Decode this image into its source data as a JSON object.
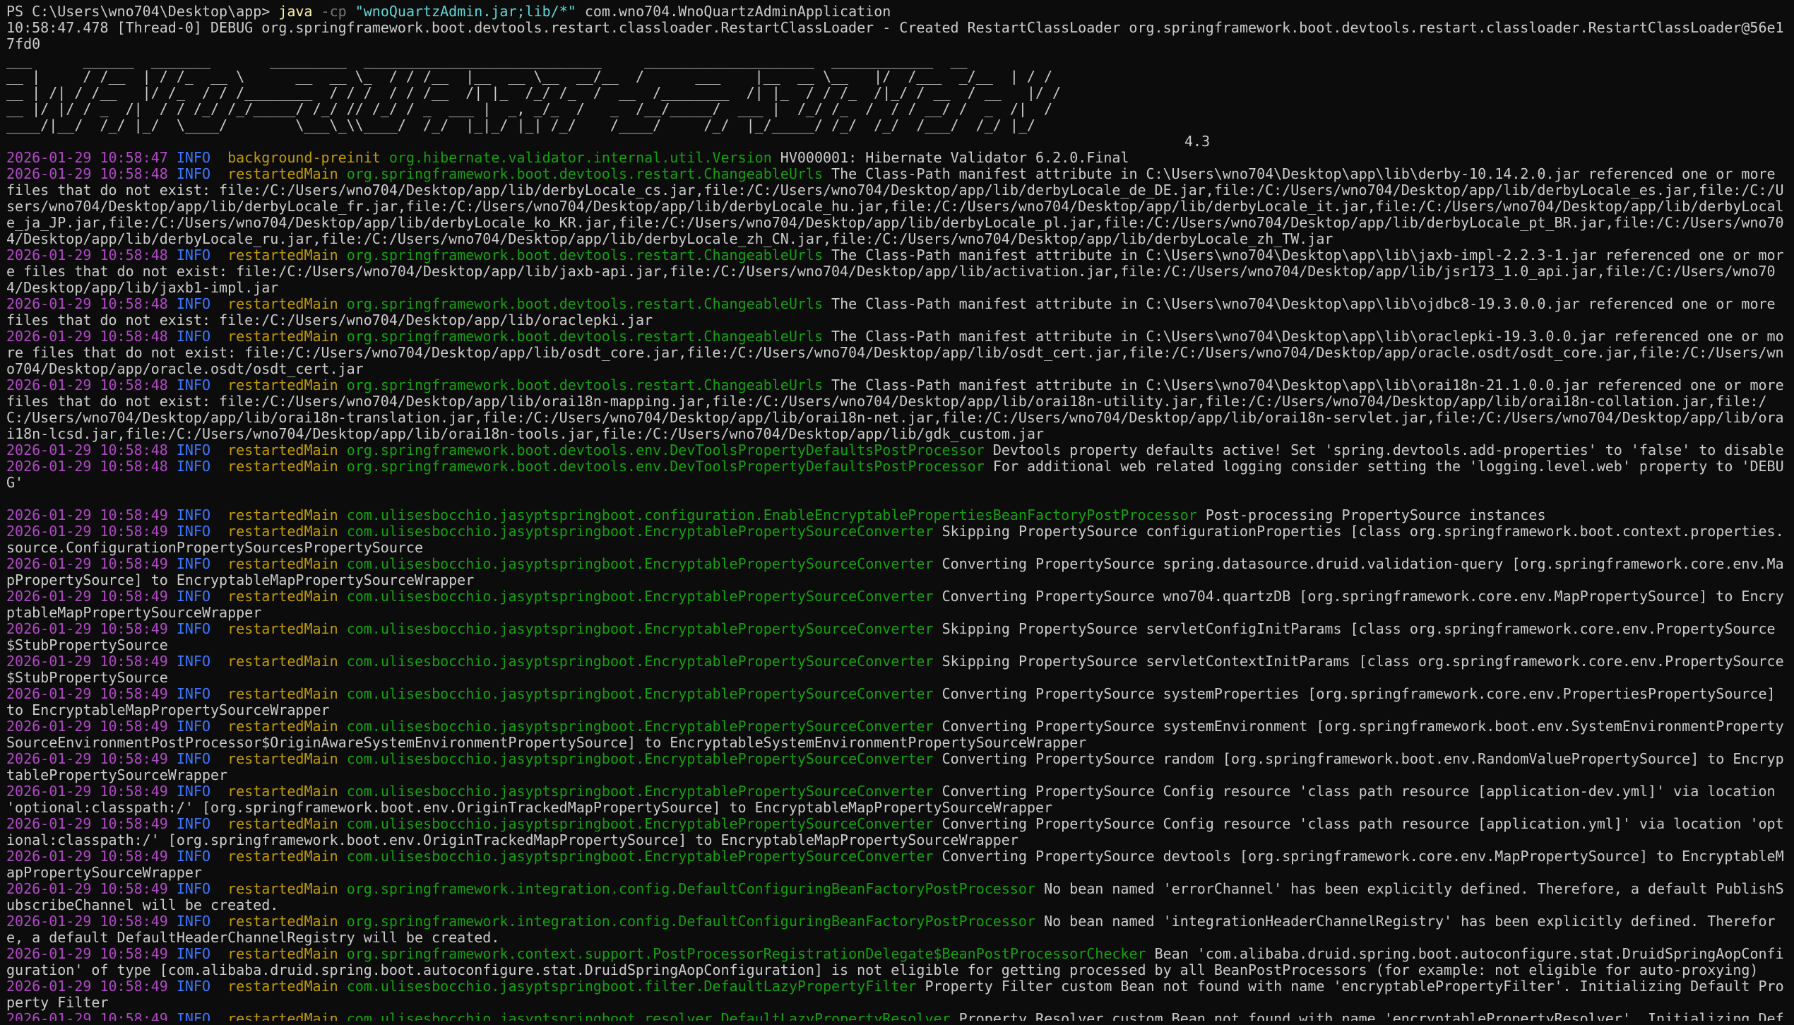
{
  "terminal": {
    "prompt": "PS C:\\Users\\wno704\\Desktop\\app> ",
    "command": {
      "program": "java",
      "flag": "-cp",
      "classpath": "\"wnoQuartzAdmin.jar;lib/*\"",
      "main_class": "com.wno704.WnoQuartzAdminApplication"
    },
    "debug_line": "10:58:47.478 [Thread-0] DEBUG org.springframework.boot.devtools.restart.classloader.RestartClassLoader - Created RestartClassLoader org.springframework.boot.devtools.restart.classloader.RestartClassLoader@56e17fd0",
    "banner_lines": [
      "___      ______  _______       _________  ____________________________     ____________________  ____________  __",
      "__ |     / /__  | / /_  __ \\      __  __ \\_  / / /__  |__  __ \\__  __/__  /      ___    |__  __ \\__   |/  /___  _/__  | / /",
      "__ | /| / /__   |/ /_  / / /________  / / /  / / /__  /| |_  /_/ /_  /  __  /________  /| |_  / / /_  /|_/ / __  / __   |/ /",
      "__ |/ |/ / _  /|  / / /_/ /_/_____/ /_/ // /_/ / _  ___ |  _, _/_  /   _  /__/_____/  ___ |  /_/ /_  /  / / __/ /  _  /|  /",
      "____/|__/  /_/ |_/  \\____/        \\___\\_\\\\____/  /_/  |_|_/ |_| /_/    /____/     /_/  |_/_____/ /_/  /_/  /___/  /_/ |_/"
    ],
    "version": "4.3",
    "log_entries": [
      {
        "date": "2026-01-29 10:58:47",
        "level": "INFO",
        "thread": "background-preinit",
        "logger": "org.hibernate.validator.internal.util.Version",
        "message": "HV000001: Hibernate Validator 6.2.0.Final"
      },
      {
        "date": "2026-01-29 10:58:48",
        "level": "INFO",
        "thread": "restartedMain",
        "logger": "org.springframework.boot.devtools.restart.ChangeableUrls",
        "message": "The Class-Path manifest attribute in C:\\Users\\wno704\\Desktop\\app\\lib\\derby-10.14.2.0.jar referenced one or more files that do not exist: file:/C:/Users/wno704/Desktop/app/lib/derbyLocale_cs.jar,file:/C:/Users/wno704/Desktop/app/lib/derbyLocale_de_DE.jar,file:/C:/Users/wno704/Desktop/app/lib/derbyLocale_es.jar,file:/C:/Users/wno704/Desktop/app/lib/derbyLocale_fr.jar,file:/C:/Users/wno704/Desktop/app/lib/derbyLocale_hu.jar,file:/C:/Users/wno704/Desktop/app/lib/derbyLocale_it.jar,file:/C:/Users/wno704/Desktop/app/lib/derbyLocale_ja_JP.jar,file:/C:/Users/wno704/Desktop/app/lib/derbyLocale_ko_KR.jar,file:/C:/Users/wno704/Desktop/app/lib/derbyLocale_pl.jar,file:/C:/Users/wno704/Desktop/app/lib/derbyLocale_pt_BR.jar,file:/C:/Users/wno704/Desktop/app/lib/derbyLocale_ru.jar,file:/C:/Users/wno704/Desktop/app/lib/derbyLocale_zh_CN.jar,file:/C:/Users/wno704/Desktop/app/lib/derbyLocale_zh_TW.jar"
      },
      {
        "date": "2026-01-29 10:58:48",
        "level": "INFO",
        "thread": "restartedMain",
        "logger": "org.springframework.boot.devtools.restart.ChangeableUrls",
        "message": "The Class-Path manifest attribute in C:\\Users\\wno704\\Desktop\\app\\lib\\jaxb-impl-2.2.3-1.jar referenced one or more files that do not exist: file:/C:/Users/wno704/Desktop/app/lib/jaxb-api.jar,file:/C:/Users/wno704/Desktop/app/lib/activation.jar,file:/C:/Users/wno704/Desktop/app/lib/jsr173_1.0_api.jar,file:/C:/Users/wno704/Desktop/app/lib/jaxb1-impl.jar"
      },
      {
        "date": "2026-01-29 10:58:48",
        "level": "INFO",
        "thread": "restartedMain",
        "logger": "org.springframework.boot.devtools.restart.ChangeableUrls",
        "message": "The Class-Path manifest attribute in C:\\Users\\wno704\\Desktop\\app\\lib\\ojdbc8-19.3.0.0.jar referenced one or more files that do not exist: file:/C:/Users/wno704/Desktop/app/lib/oraclepki.jar"
      },
      {
        "date": "2026-01-29 10:58:48",
        "level": "INFO",
        "thread": "restartedMain",
        "logger": "org.springframework.boot.devtools.restart.ChangeableUrls",
        "message": "The Class-Path manifest attribute in C:\\Users\\wno704\\Desktop\\app\\lib\\oraclepki-19.3.0.0.jar referenced one or more files that do not exist: file:/C:/Users/wno704/Desktop/app/lib/osdt_core.jar,file:/C:/Users/wno704/Desktop/app/lib/osdt_cert.jar,file:/C:/Users/wno704/Desktop/app/oracle.osdt/osdt_core.jar,file:/C:/Users/wno704/Desktop/app/oracle.osdt/osdt_cert.jar"
      },
      {
        "date": "2026-01-29 10:58:48",
        "level": "INFO",
        "thread": "restartedMain",
        "logger": "org.springframework.boot.devtools.restart.ChangeableUrls",
        "message": "The Class-Path manifest attribute in C:\\Users\\wno704\\Desktop\\app\\lib\\orai18n-21.1.0.0.jar referenced one or more files that do not exist: file:/C:/Users/wno704/Desktop/app/lib/orai18n-mapping.jar,file:/C:/Users/wno704/Desktop/app/lib/orai18n-utility.jar,file:/C:/Users/wno704/Desktop/app/lib/orai18n-collation.jar,file:/C:/Users/wno704/Desktop/app/lib/orai18n-translation.jar,file:/C:/Users/wno704/Desktop/app/lib/orai18n-net.jar,file:/C:/Users/wno704/Desktop/app/lib/orai18n-servlet.jar,file:/C:/Users/wno704/Desktop/app/lib/orai18n-lcsd.jar,file:/C:/Users/wno704/Desktop/app/lib/orai18n-tools.jar,file:/C:/Users/wno704/Desktop/app/lib/gdk_custom.jar"
      },
      {
        "date": "2026-01-29 10:58:48",
        "level": "INFO",
        "thread": "restartedMain",
        "logger": "org.springframework.boot.devtools.env.DevToolsPropertyDefaultsPostProcessor",
        "message": "Devtools property defaults active! Set 'spring.devtools.add-properties' to 'false' to disable"
      },
      {
        "date": "2026-01-29 10:58:48",
        "level": "INFO",
        "thread": "restartedMain",
        "logger": "org.springframework.boot.devtools.env.DevToolsPropertyDefaultsPostProcessor",
        "message": "For additional web related logging consider setting the 'logging.level.web' property to 'DEBUG'"
      },
      {
        "date": "",
        "level": "",
        "thread": "",
        "logger": "",
        "message": ""
      },
      {
        "date": "2026-01-29 10:58:49",
        "level": "INFO",
        "thread": "restartedMain",
        "logger": "com.ulisesbocchio.jasyptspringboot.configuration.EnableEncryptablePropertiesBeanFactoryPostProcessor",
        "message": "Post-processing PropertySource instances"
      },
      {
        "date": "2026-01-29 10:58:49",
        "level": "INFO",
        "thread": "restartedMain",
        "logger": "com.ulisesbocchio.jasyptspringboot.EncryptablePropertySourceConverter",
        "message": "Skipping PropertySource configurationProperties [class org.springframework.boot.context.properties.source.ConfigurationPropertySourcesPropertySource"
      },
      {
        "date": "2026-01-29 10:58:49",
        "level": "INFO",
        "thread": "restartedMain",
        "logger": "com.ulisesbocchio.jasyptspringboot.EncryptablePropertySourceConverter",
        "message": "Converting PropertySource spring.datasource.druid.validation-query [org.springframework.core.env.MapPropertySource] to EncryptableMapPropertySourceWrapper"
      },
      {
        "date": "2026-01-29 10:58:49",
        "level": "INFO",
        "thread": "restartedMain",
        "logger": "com.ulisesbocchio.jasyptspringboot.EncryptablePropertySourceConverter",
        "message": "Converting PropertySource wno704.quartzDB [org.springframework.core.env.MapPropertySource] to EncryptableMapPropertySourceWrapper"
      },
      {
        "date": "2026-01-29 10:58:49",
        "level": "INFO",
        "thread": "restartedMain",
        "logger": "com.ulisesbocchio.jasyptspringboot.EncryptablePropertySourceConverter",
        "message": "Skipping PropertySource servletConfigInitParams [class org.springframework.core.env.PropertySource$StubPropertySource"
      },
      {
        "date": "2026-01-29 10:58:49",
        "level": "INFO",
        "thread": "restartedMain",
        "logger": "com.ulisesbocchio.jasyptspringboot.EncryptablePropertySourceConverter",
        "message": "Skipping PropertySource servletContextInitParams [class org.springframework.core.env.PropertySource$StubPropertySource"
      },
      {
        "date": "2026-01-29 10:58:49",
        "level": "INFO",
        "thread": "restartedMain",
        "logger": "com.ulisesbocchio.jasyptspringboot.EncryptablePropertySourceConverter",
        "message": "Converting PropertySource systemProperties [org.springframework.core.env.PropertiesPropertySource] to EncryptableMapPropertySourceWrapper"
      },
      {
        "date": "2026-01-29 10:58:49",
        "level": "INFO",
        "thread": "restartedMain",
        "logger": "com.ulisesbocchio.jasyptspringboot.EncryptablePropertySourceConverter",
        "message": "Converting PropertySource systemEnvironment [org.springframework.boot.env.SystemEnvironmentPropertySourceEnvironmentPostProcessor$OriginAwareSystemEnvironmentPropertySource] to EncryptableSystemEnvironmentPropertySourceWrapper"
      },
      {
        "date": "2026-01-29 10:58:49",
        "level": "INFO",
        "thread": "restartedMain",
        "logger": "com.ulisesbocchio.jasyptspringboot.EncryptablePropertySourceConverter",
        "message": "Converting PropertySource random [org.springframework.boot.env.RandomValuePropertySource] to EncryptablePropertySourceWrapper"
      },
      {
        "date": "2026-01-29 10:58:49",
        "level": "INFO",
        "thread": "restartedMain",
        "logger": "com.ulisesbocchio.jasyptspringboot.EncryptablePropertySourceConverter",
        "message": "Converting PropertySource Config resource 'class path resource [application-dev.yml]' via location 'optional:classpath:/' [org.springframework.boot.env.OriginTrackedMapPropertySource] to EncryptableMapPropertySourceWrapper"
      },
      {
        "date": "2026-01-29 10:58:49",
        "level": "INFO",
        "thread": "restartedMain",
        "logger": "com.ulisesbocchio.jasyptspringboot.EncryptablePropertySourceConverter",
        "message": "Converting PropertySource Config resource 'class path resource [application.yml]' via location 'optional:classpath:/' [org.springframework.boot.env.OriginTrackedMapPropertySource] to EncryptableMapPropertySourceWrapper"
      },
      {
        "date": "2026-01-29 10:58:49",
        "level": "INFO",
        "thread": "restartedMain",
        "logger": "com.ulisesbocchio.jasyptspringboot.EncryptablePropertySourceConverter",
        "message": "Converting PropertySource devtools [org.springframework.core.env.MapPropertySource] to EncryptableMapPropertySourceWrapper"
      },
      {
        "date": "2026-01-29 10:58:49",
        "level": "INFO",
        "thread": "restartedMain",
        "logger": "org.springframework.integration.config.DefaultConfiguringBeanFactoryPostProcessor",
        "message": "No bean named 'errorChannel' has been explicitly defined. Therefore, a default PublishSubscribeChannel will be created."
      },
      {
        "date": "2026-01-29 10:58:49",
        "level": "INFO",
        "thread": "restartedMain",
        "logger": "org.springframework.integration.config.DefaultConfiguringBeanFactoryPostProcessor",
        "message": "No bean named 'integrationHeaderChannelRegistry' has been explicitly defined. Therefore, a default DefaultHeaderChannelRegistry will be created."
      },
      {
        "date": "2026-01-29 10:58:49",
        "level": "INFO",
        "thread": "restartedMain",
        "logger": "org.springframework.context.support.PostProcessorRegistrationDelegate$BeanPostProcessorChecker",
        "message": "Bean 'com.alibaba.druid.spring.boot.autoconfigure.stat.DruidSpringAopConfiguration' of type [com.alibaba.druid.spring.boot.autoconfigure.stat.DruidSpringAopConfiguration] is not eligible for getting processed by all BeanPostProcessors (for example: not eligible for auto-proxying)"
      },
      {
        "date": "2026-01-29 10:58:49",
        "level": "INFO",
        "thread": "restartedMain",
        "logger": "com.ulisesbocchio.jasyptspringboot.filter.DefaultLazyPropertyFilter",
        "message": "Property Filter custom Bean not found with name 'encryptablePropertyFilter'. Initializing Default Property Filter"
      },
      {
        "date": "2026-01-29 10:58:49",
        "level": "INFO",
        "thread": "restartedMain",
        "logger": "com.ulisesbocchio.jasyptspringboot.resolver.DefaultLazyPropertyResolver",
        "message": "Property Resolver custom Bean not found with name 'encryptablePropertyResolver'. Initializing Default Property Resolver"
      }
    ]
  },
  "colors": {
    "background": "#0c0c0c",
    "text": "#cccccc",
    "date": "#b148c6",
    "level": "#3b78ff",
    "thread": "#c19c00",
    "logger": "#13a10e",
    "command": "#f9f1a5",
    "string": "#61d6d6"
  }
}
